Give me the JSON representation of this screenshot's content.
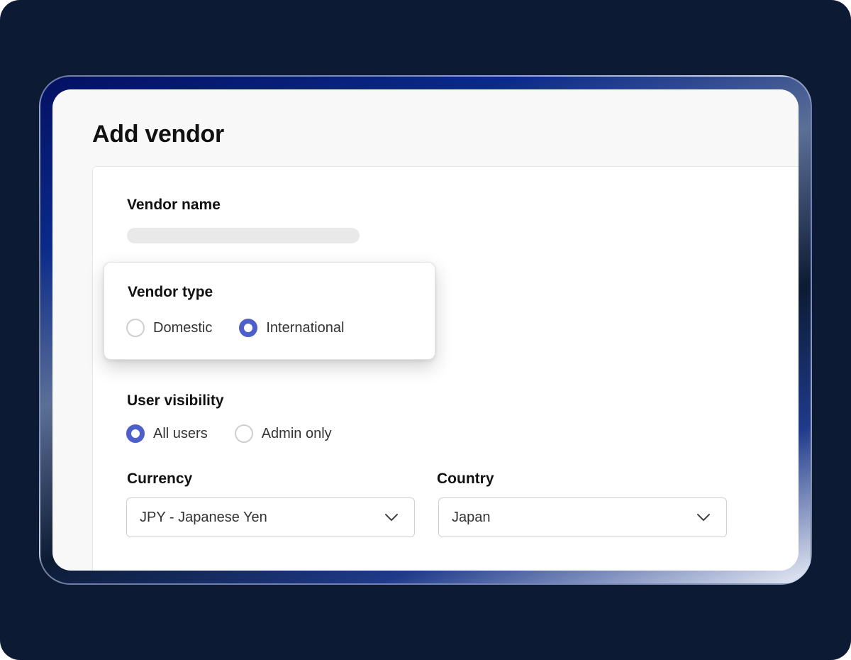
{
  "page": {
    "title": "Add vendor"
  },
  "form": {
    "vendor_name": {
      "label": "Vendor name"
    },
    "vendor_type": {
      "label": "Vendor type",
      "options": [
        {
          "label": "Domestic",
          "selected": false
        },
        {
          "label": "International",
          "selected": true
        }
      ]
    },
    "user_visibility": {
      "label": "User visibility",
      "options": [
        {
          "label": "All users",
          "selected": true
        },
        {
          "label": "Admin only",
          "selected": false
        }
      ]
    },
    "currency": {
      "label": "Currency",
      "value": "JPY - Japanese Yen"
    },
    "country": {
      "label": "Country",
      "value": "Japan"
    }
  },
  "icons": {
    "dropdown": "chevron-down-icon"
  },
  "colors": {
    "accent": "#4e5fc9",
    "background": "#0c1b33",
    "card": "#f8f8f8",
    "panel": "#ffffff",
    "text": "#111111"
  }
}
